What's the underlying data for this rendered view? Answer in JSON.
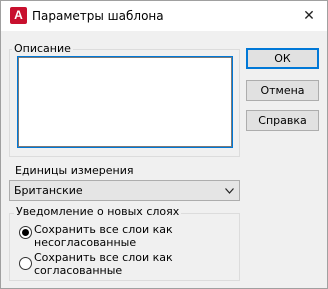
{
  "window": {
    "title": "Параметры шаблона",
    "app_icon_letter": "A",
    "close_glyph": "✕"
  },
  "description": {
    "label": "Описание",
    "value": ""
  },
  "buttons": {
    "ok": "ОК",
    "cancel": "Отмена",
    "help": "Справка"
  },
  "units": {
    "label": "Единицы измерения",
    "selected": "Британские"
  },
  "layer_notification": {
    "label": "Уведомление о новых слоях",
    "options": [
      {
        "line1": "Сохранить все слои как",
        "line2": "несогласованные",
        "checked": true
      },
      {
        "line1": "Сохранить все слои как",
        "line2": "согласованные",
        "checked": false
      }
    ]
  },
  "colors": {
    "accent": "#0078d7",
    "autocad_red": "#c8102e"
  }
}
